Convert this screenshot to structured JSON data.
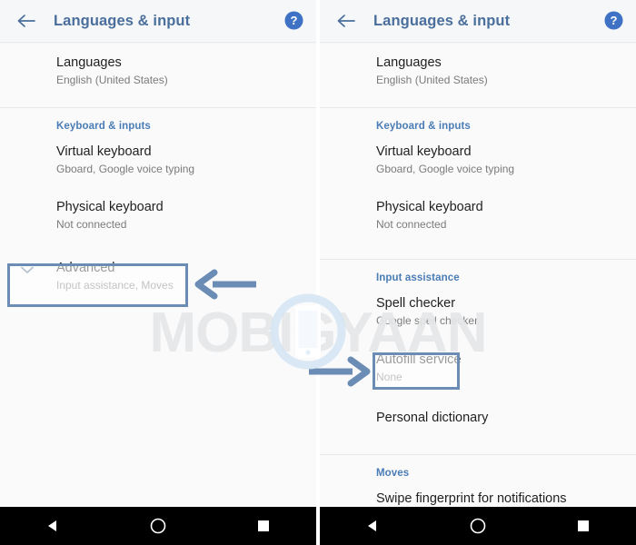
{
  "colors": {
    "accent_blue": "#4a7cb5",
    "title_blue": "#4a6f9c",
    "highlight_border": "#6b8cb4",
    "arrow": "#6b8cb4",
    "page_bg": "#fafafa",
    "appbar_bg": "#f6f7f8",
    "navbar_bg": "#000000"
  },
  "appbar": {
    "title": "Languages & input",
    "back_icon": "arrow-left-icon",
    "help_icon": "help-circle-icon"
  },
  "watermark": {
    "text": "MOBIGYAAN",
    "logo": "phone-in-circle-logo"
  },
  "navbar": {
    "back": "triangle-back-icon",
    "home": "circle-home-icon",
    "recents": "square-recents-icon"
  },
  "left_panel": {
    "rows": [
      {
        "title": "Languages",
        "sub": "English (United States)"
      }
    ],
    "section_keyboard": "Keyboard & inputs",
    "keyboard_rows": [
      {
        "title": "Virtual keyboard",
        "sub": "Gboard, Google voice typing"
      },
      {
        "title": "Physical keyboard",
        "sub": "Not connected"
      }
    ],
    "advanced": {
      "title": "Advanced",
      "sub": "Input assistance, Moves",
      "chevron": "chevron-down-icon"
    },
    "annotation_arrow": "arrow-left-annotation"
  },
  "right_panel": {
    "rows": [
      {
        "title": "Languages",
        "sub": "English (United States)"
      }
    ],
    "section_keyboard": "Keyboard & inputs",
    "keyboard_rows": [
      {
        "title": "Virtual keyboard",
        "sub": "Gboard, Google voice typing"
      },
      {
        "title": "Physical keyboard",
        "sub": "Not connected"
      }
    ],
    "section_input_assistance": "Input assistance",
    "input_rows": [
      {
        "title": "Spell checker",
        "sub": "Google spell checker"
      },
      {
        "title": "Autofill service",
        "sub": "None"
      },
      {
        "title": "Personal dictionary",
        "sub": ""
      }
    ],
    "section_moves": "Moves",
    "moves_rows": [
      {
        "title": "Swipe fingerprint for notifications",
        "sub": ""
      }
    ],
    "annotation_arrow": "arrow-right-annotation"
  }
}
